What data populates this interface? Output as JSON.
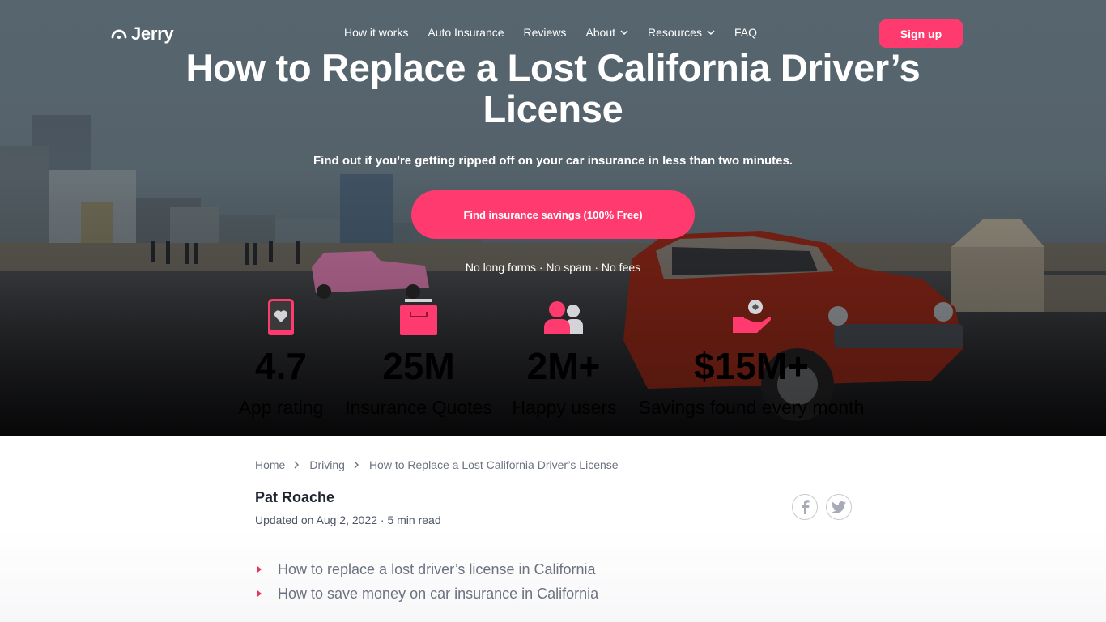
{
  "brand": {
    "name": "Jerry",
    "accent_color": "#ff3a6e"
  },
  "nav": {
    "links": [
      {
        "label": "How it works",
        "has_dropdown": false
      },
      {
        "label": "Auto Insurance",
        "has_dropdown": false
      },
      {
        "label": "Reviews",
        "has_dropdown": false
      },
      {
        "label": "About",
        "has_dropdown": true
      },
      {
        "label": "Resources",
        "has_dropdown": true
      },
      {
        "label": "FAQ",
        "has_dropdown": false
      }
    ],
    "signup_label": "Sign up"
  },
  "hero": {
    "title": "How to Replace a Lost California Driver’s License",
    "subtitle": "Find out if you're getting ripped off on your car insurance in less than two minutes.",
    "cta_label": "Find insurance savings (100% Free)",
    "no_forms_text": "No long forms · No spam · No fees",
    "stats": [
      {
        "icon": "phone-heart-icon",
        "value": "4.7",
        "label": "App rating"
      },
      {
        "icon": "quotes-box-icon",
        "value": "25M",
        "label": "Insurance Quotes"
      },
      {
        "icon": "users-icon",
        "value": "2M+",
        "label": "Happy users"
      },
      {
        "icon": "hand-coin-icon",
        "value": "$15M+",
        "label": "Savings found every month"
      }
    ]
  },
  "article": {
    "breadcrumb": [
      "Home",
      "Driving",
      "How to Replace a Lost California Driver’s License"
    ],
    "author": "Pat Roache",
    "meta": "Updated on Aug 2, 2022 · 5 min read",
    "share": [
      {
        "icon": "facebook-icon"
      },
      {
        "icon": "twitter-icon"
      }
    ],
    "toc": [
      "How to replace a lost driver’s license in California",
      "How to save money on car insurance in California"
    ]
  }
}
